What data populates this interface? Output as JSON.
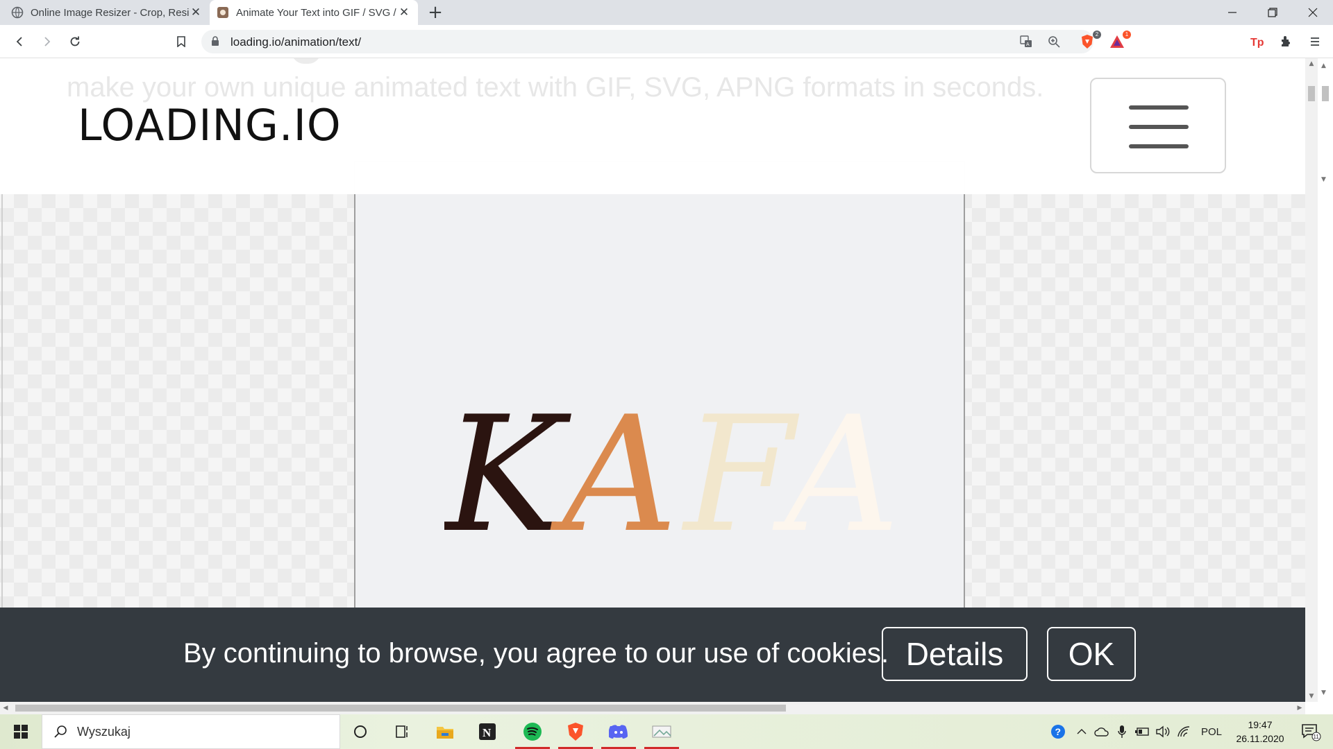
{
  "browser": {
    "tabs": [
      {
        "title": "Online Image Resizer - Crop, Resiz",
        "close": "✕",
        "active": false
      },
      {
        "title": "Animate Your Text into GIF / SVG /",
        "close": "✕",
        "active": true
      }
    ],
    "new_tab": "+",
    "url": "loading.io/animation/text/",
    "brave_badge": "2",
    "rewards_badge": "1",
    "icons": [
      "back-icon",
      "forward-icon",
      "reload-icon",
      "bookmark-icon",
      "lock-icon",
      "translate-icon",
      "zoom-icon",
      "brave-shield-icon",
      "brave-rewards-icon",
      "tp-extension-icon",
      "extensions-icon",
      "menu-icon"
    ]
  },
  "page": {
    "tagline": "make your own unique animated text with GIF, SVG, APNG formats in seconds.",
    "logo": "LOADING.IO",
    "preview": {
      "letters": [
        "K",
        "A",
        "F",
        "A"
      ],
      "colors": [
        "#2b1410",
        "#db8a4e",
        "#f2e7cd",
        "#fdf6ed"
      ]
    },
    "cookie": {
      "message": "By continuing to browse, you agree to our use of cookies.",
      "details": "Details",
      "ok": "OK"
    }
  },
  "taskbar": {
    "search_placeholder": "Wyszukaj",
    "apps": [
      "cortana-icon",
      "task-view-icon",
      "file-explorer-icon",
      "notion-icon",
      "spotify-icon",
      "brave-icon",
      "discord-icon",
      "other-app-icon"
    ],
    "language": "POL",
    "time": "19:47",
    "date": "26.11.2020",
    "notifications": "11"
  }
}
